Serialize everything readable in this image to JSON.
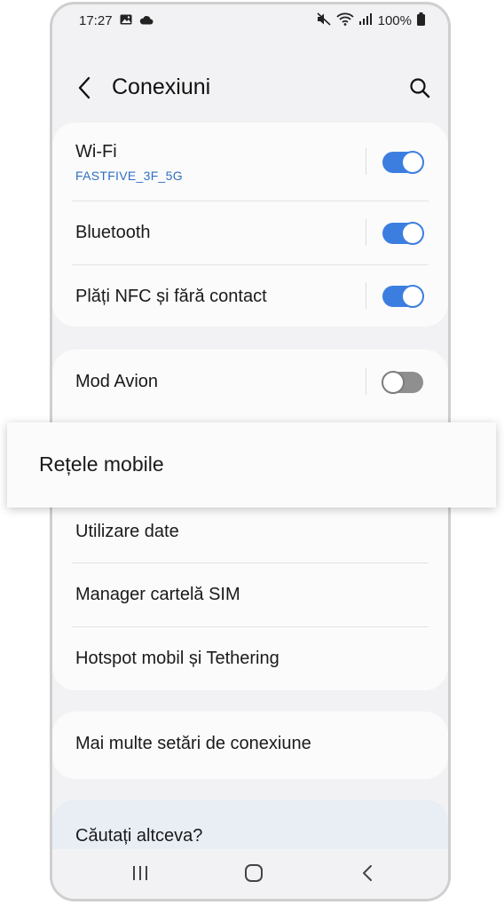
{
  "status_bar": {
    "time": "17:27",
    "battery": "100%",
    "left_icons": [
      "gallery-icon",
      "cloud-icon"
    ],
    "right_icons": [
      "mute-icon",
      "wifi-icon",
      "signal-icon",
      "battery-icon"
    ]
  },
  "header": {
    "title": "Conexiuni",
    "back_icon": "back-arrow-icon",
    "search_icon": "search-icon"
  },
  "group1": {
    "wifi": {
      "label": "Wi-Fi",
      "network": "FASTFIVE_3F_5G",
      "enabled": true
    },
    "bluetooth": {
      "label": "Bluetooth",
      "enabled": true
    },
    "nfc": {
      "label": "Plăți NFC și fără contact",
      "enabled": true
    }
  },
  "group2": {
    "airplane": {
      "label": "Mod Avion",
      "enabled": false
    },
    "mobile_networks": {
      "label": "Rețele mobile"
    },
    "data_usage": {
      "label": "Utilizare date"
    },
    "sim_manager": {
      "label": "Manager cartelă SIM"
    },
    "hotspot": {
      "label": "Hotspot mobil și Tethering"
    }
  },
  "group3": {
    "more": {
      "label": "Mai multe setări de conexiune"
    }
  },
  "suggest": {
    "label": "Căutați altceva?"
  },
  "nav": {
    "recents_icon": "recents-icon",
    "home_icon": "home-icon",
    "back_icon": "nav-back-icon"
  },
  "colors": {
    "accent": "#3c7ee0",
    "network_text": "#2f6fc4",
    "toggle_off": "#8f8f8f",
    "background": "#f2f2f4",
    "card": "#fbfbfb",
    "suggest_card": "#e9eef5"
  }
}
